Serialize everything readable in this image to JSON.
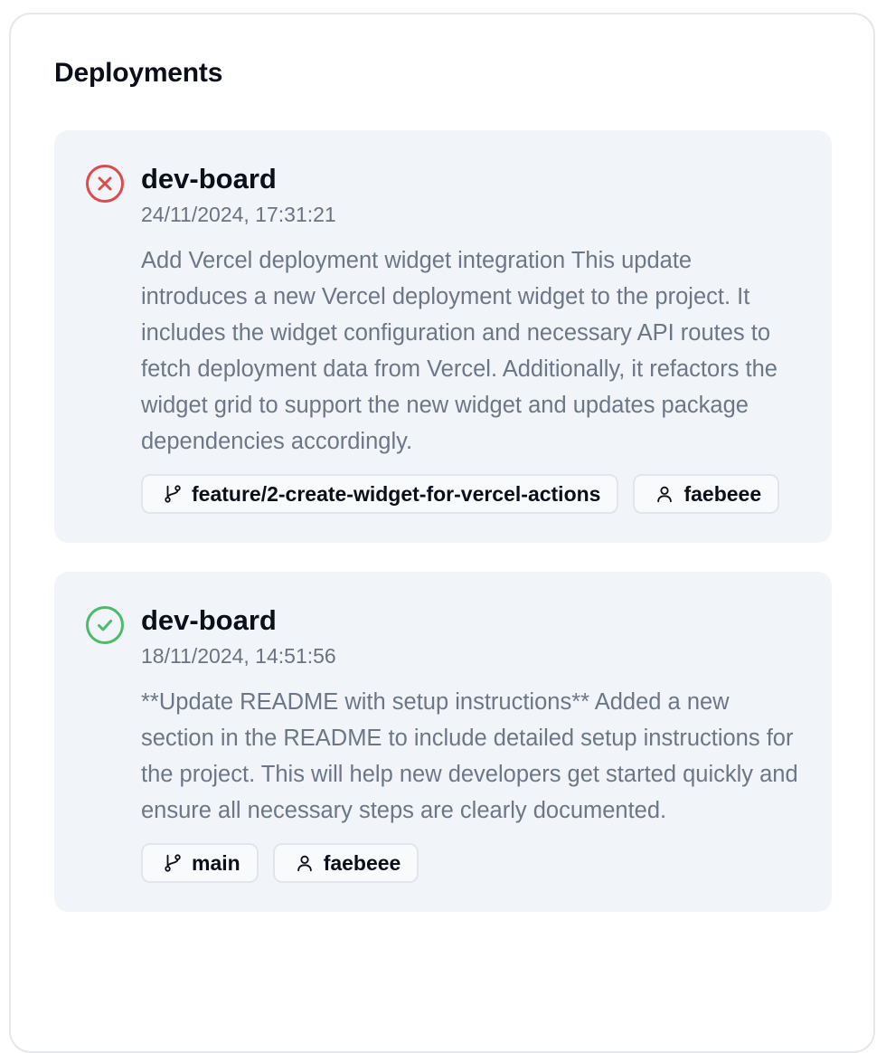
{
  "widget": {
    "title": "Deployments"
  },
  "deployments": [
    {
      "status": "error",
      "status_icon": "x-circle-icon",
      "status_color": "#dc4c4c",
      "name": "dev-board",
      "timestamp": "24/11/2024, 17:31:21",
      "message": "Add Vercel deployment widget integration This update introduces a new Vercel deployment widget to the project. It includes the widget configuration and necessary API routes to fetch deployment data from Vercel. Additionally, it refactors the widget grid to support the new widget and updates package dependencies accordingly.",
      "branch": "feature/2-create-widget-for-vercel-actions",
      "author": "faebeee"
    },
    {
      "status": "success",
      "status_icon": "check-circle-icon",
      "status_color": "#4cbb6a",
      "name": "dev-board",
      "timestamp": "18/11/2024, 14:51:56",
      "message": "**Update README with setup instructions** Added a new section in the README to include detailed setup instructions for the project. This will help new developers get started quickly and ensure all necessary steps are clearly documented.",
      "branch": "main",
      "author": "faebeee"
    }
  ]
}
